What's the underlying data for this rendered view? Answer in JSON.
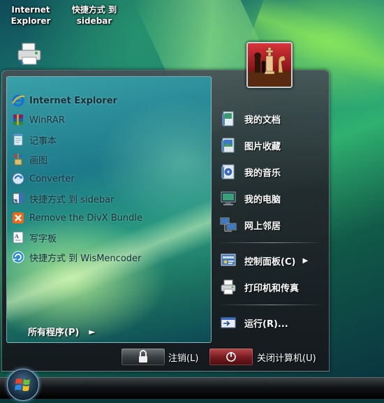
{
  "desktop": {
    "icons": [
      {
        "label": "Internet\nExplorer"
      },
      {
        "label": "快捷方式 到\nsidebar"
      }
    ]
  },
  "start_menu": {
    "programs": [
      {
        "label": "Internet Explorer",
        "icon": "ie-icon",
        "bold": true
      },
      {
        "label": "WinRAR",
        "icon": "winrar-icon"
      },
      {
        "label": "记事本",
        "icon": "notepad-icon"
      },
      {
        "label": "画图",
        "icon": "paint-icon"
      },
      {
        "label": "Converter",
        "icon": "converter-icon"
      },
      {
        "label": "快捷方式 到 sidebar",
        "icon": "sidebar-shortcut-icon"
      },
      {
        "label": "Remove the DivX Bundle",
        "icon": "divx-remove-icon"
      },
      {
        "label": "写字板",
        "icon": "wordpad-icon"
      },
      {
        "label": "快捷方式 到 WisMencoder",
        "icon": "wismencoder-icon"
      }
    ],
    "all_programs": "所有程序(P)",
    "right_items": [
      {
        "label": "我的文档",
        "icon": "documents-icon"
      },
      {
        "label": "图片收藏",
        "icon": "pictures-icon"
      },
      {
        "label": "我的音乐",
        "icon": "music-icon"
      },
      {
        "label": "我的电脑",
        "icon": "computer-icon"
      },
      {
        "label": "网上邻居",
        "icon": "network-icon"
      },
      {
        "label": "控制面板(C)",
        "icon": "control-panel-icon",
        "submenu": true
      },
      {
        "label": "打印机和传真",
        "icon": "printer-icon"
      },
      {
        "label": "运行(R)...",
        "icon": "run-icon"
      }
    ],
    "logoff_label": "注销(L)",
    "shutdown_label": "关闭计算机(U)"
  },
  "colors": {
    "menu_bg": "#1c2024",
    "left_panel_accent": "#2a9a7e",
    "shutdown_red": "#7a1c20"
  }
}
